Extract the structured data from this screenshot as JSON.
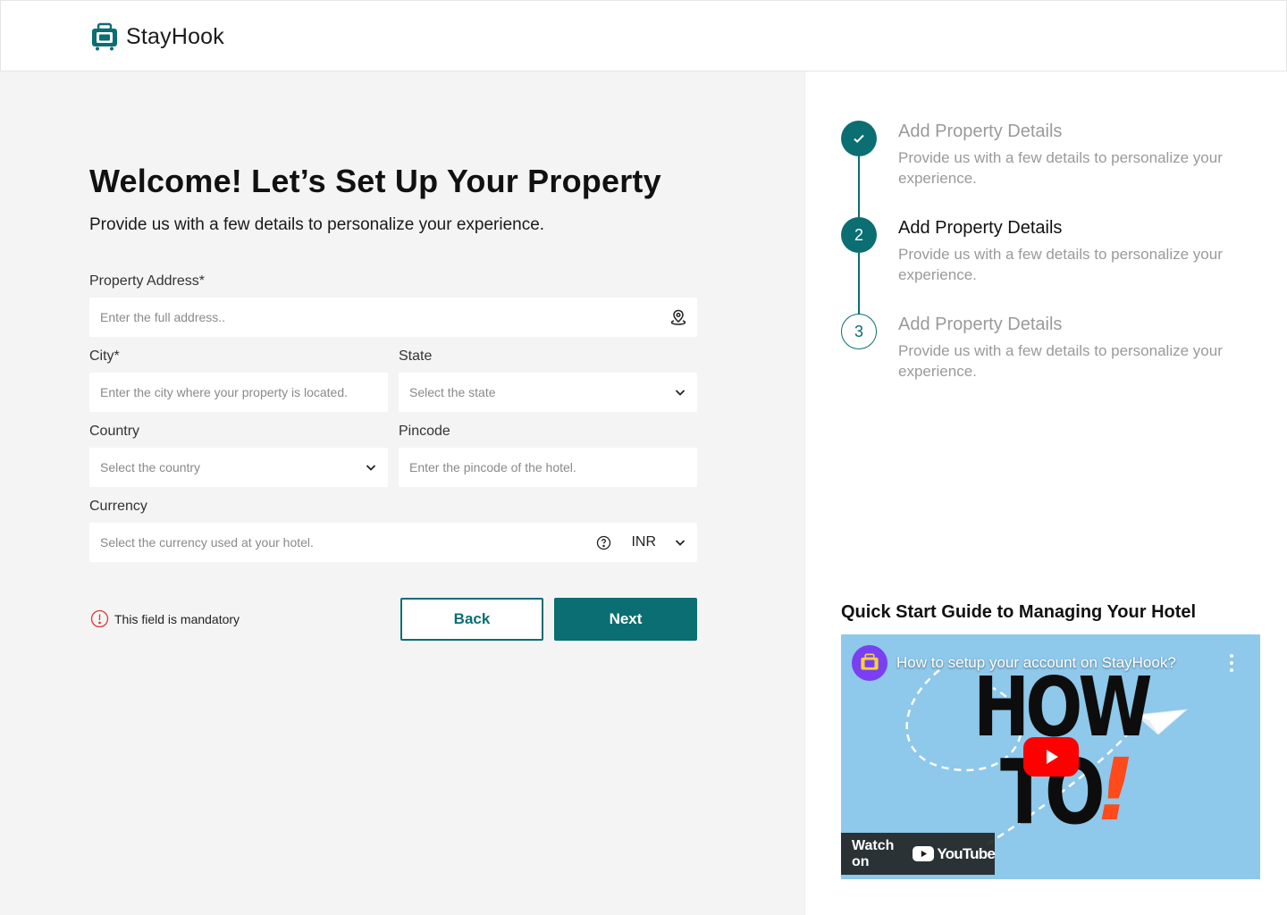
{
  "brand": {
    "name": "StayHook"
  },
  "form": {
    "title": "Welcome! Let’s Set Up Your Property",
    "subtitle": "Provide us with a few details to personalize your experience.",
    "address": {
      "label": "Property Address*",
      "placeholder": "Enter the full address.."
    },
    "city": {
      "label": "City*",
      "placeholder": "Enter the city where your property is located."
    },
    "state": {
      "label": "State",
      "placeholder": "Select the state"
    },
    "country": {
      "label": "Country",
      "placeholder": "Select the country"
    },
    "pincode": {
      "label": "Pincode",
      "placeholder": "Enter the pincode of the hotel."
    },
    "currency": {
      "label": "Currency",
      "placeholder": "Select the currency used at your hotel.",
      "value": "INR"
    },
    "mandatory_note": "This field is mandatory",
    "back_label": "Back",
    "next_label": "Next"
  },
  "steps": [
    {
      "marker": "✓",
      "title": "Add Property Details",
      "desc": "Provide us with a few details to personalize your experience.",
      "state": "completed"
    },
    {
      "marker": "2",
      "title": "Add Property Details",
      "desc": "Provide us with a few details to personalize your experience.",
      "state": "active"
    },
    {
      "marker": "3",
      "title": "Add Property Details",
      "desc": "Provide us with a few details to personalize your experience.",
      "state": "upcoming"
    }
  ],
  "guide": {
    "title": "Quick Start Guide to Managing Your Hotel",
    "video_title": "How to setup your account on StayHook?",
    "thumb_line1": "HOW",
    "thumb_line2": "TO",
    "thumb_mark": "!",
    "watch_on": "Watch on",
    "youtube": "YouTube"
  },
  "colors": {
    "primary": "#0a6e73",
    "error": "#d93a3a",
    "youtube_red": "#ff0000"
  }
}
